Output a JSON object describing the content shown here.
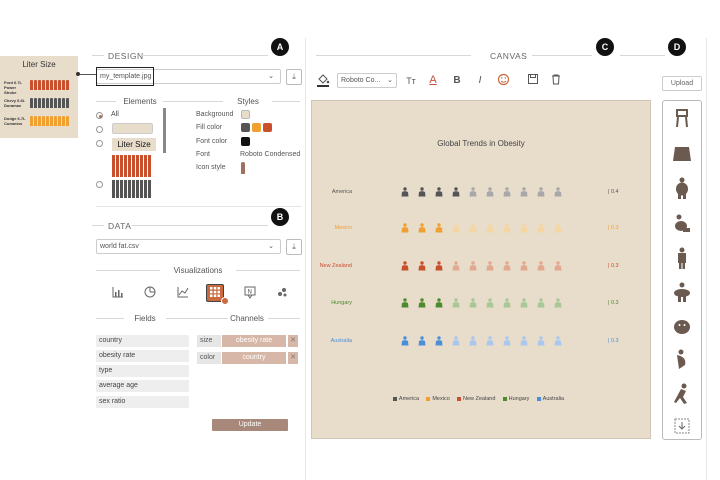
{
  "thumbnail": {
    "title": "Liter Size",
    "rows": [
      {
        "label": "Ford 6.7L Power Stroke",
        "color": "#c8502c"
      },
      {
        "label": "Chevy 6.6L Duramax",
        "color": "#555555"
      },
      {
        "label": "Dodge 6.7L Cummins",
        "color": "#f0a030"
      }
    ]
  },
  "design": {
    "heading": "DESIGN",
    "badge": "A",
    "template_file": "my_template.jpg",
    "elements_heading": "Elements",
    "styles_heading": "Styles",
    "element_all_label": "All",
    "element_text_label": "Liter Size",
    "styles": {
      "background_label": "Background",
      "fill_color_label": "Fill color",
      "font_color_label": "Font color",
      "font_label": "Font",
      "font_value": "Roboto Condensed",
      "icon_style_label": "Icon style",
      "background_color": "#e8dccb",
      "fill_colors": [
        "#555555",
        "#f0a030",
        "#c8502c"
      ],
      "font_color": "#111111"
    }
  },
  "data": {
    "heading": "DATA",
    "badge": "B",
    "file": "world fat.csv",
    "visualizations_heading": "Visualizations",
    "vis_icons": [
      "bar-chart-icon",
      "pie-chart-icon",
      "line-chart-icon",
      "pictograph-grid-icon",
      "annotation-icon",
      "scatter-icon"
    ],
    "fields_heading": "Fields",
    "channels_heading": "Channels",
    "fields": [
      "country",
      "obesity rate",
      "type",
      "average age",
      "sex ratio"
    ],
    "channels": [
      {
        "label": "size",
        "value": "obesity rate"
      },
      {
        "label": "color",
        "value": "country"
      }
    ],
    "update_label": "Update"
  },
  "canvas": {
    "heading": "CANVAS",
    "badge": "C",
    "font_select": "Roboto Co...",
    "chart_title": "Global Trends in Obesity",
    "rows": [
      {
        "country": "America",
        "value_text": "| 0.4",
        "color": "#555555",
        "light": "#a8a8a8",
        "filled": 4,
        "total": 10
      },
      {
        "country": "Mexico",
        "value_text": "| 0.3",
        "color": "#f0a030",
        "light": "#f5d6a0",
        "filled": 3,
        "total": 10
      },
      {
        "country": "New Zealand",
        "value_text": "| 0.3",
        "color": "#c8502c",
        "light": "#e2a890",
        "filled": 3,
        "total": 10
      },
      {
        "country": "Hungary",
        "value_text": "| 0.3",
        "color": "#4e8a2e",
        "light": "#a8c896",
        "filled": 3,
        "total": 10
      },
      {
        "country": "Australia",
        "value_text": "| 0.3",
        "color": "#4a90d9",
        "light": "#a8c8ee",
        "filled": 3,
        "total": 10
      }
    ],
    "legend": [
      {
        "label": "America",
        "color": "#555555"
      },
      {
        "label": "Mexico",
        "color": "#f0a030"
      },
      {
        "label": "New Zealand",
        "color": "#c8502c"
      },
      {
        "label": "Hungary",
        "color": "#4e8a2e"
      },
      {
        "label": "Australia",
        "color": "#4a90d9"
      }
    ],
    "label_colors": [
      "#555555",
      "#f0a030",
      "#c8502c",
      "#4e8a2e",
      "#4a90d9"
    ]
  },
  "icons_panel": {
    "badge": "D",
    "upload_label": "Upload",
    "icons": [
      "scale-person-icon",
      "wide-torso-icon",
      "fat-person-icon",
      "sitting-person-icon",
      "standing-person-icon",
      "wide-person-icon",
      "round-person-icon",
      "side-person-icon",
      "running-person-icon",
      "download-icon"
    ]
  }
}
